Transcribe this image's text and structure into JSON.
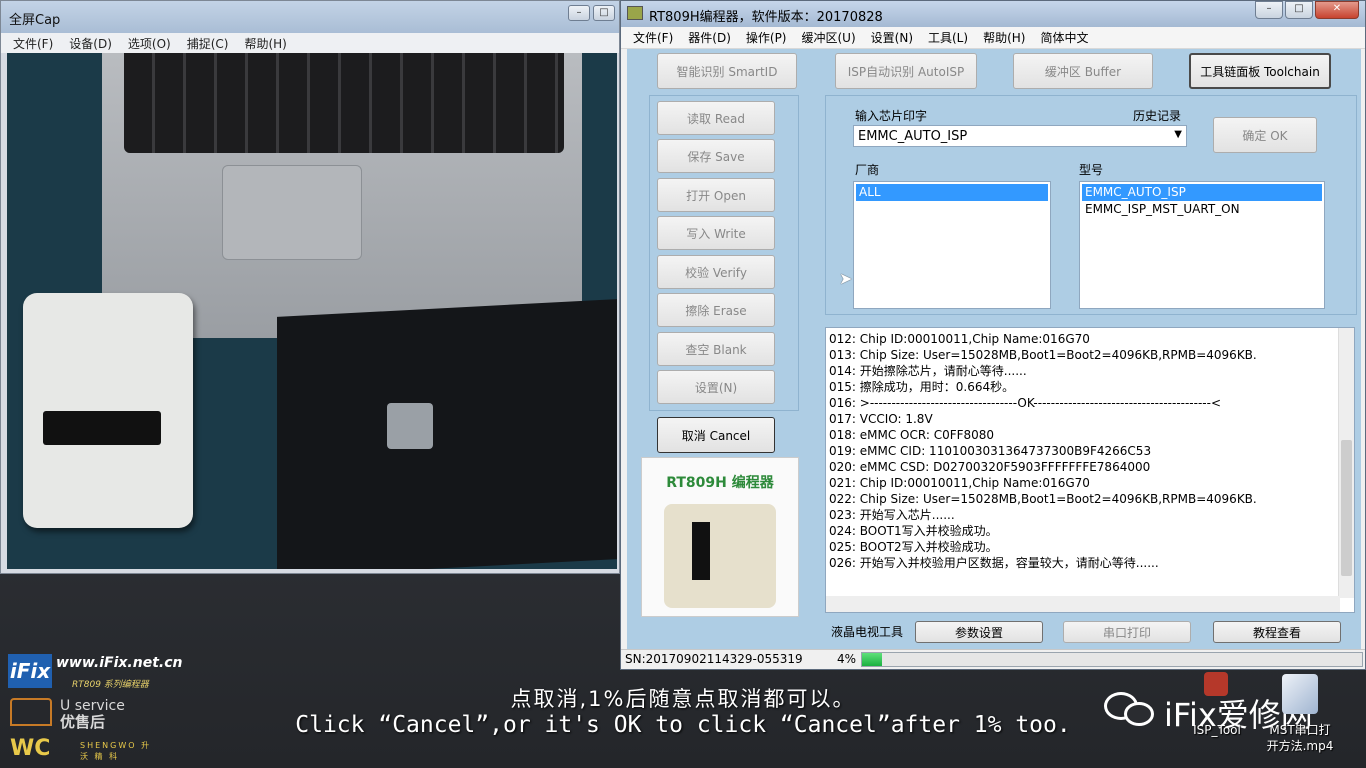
{
  "capture_window": {
    "title": "全屏Cap",
    "menu": [
      "文件(F)",
      "设备(D)",
      "选项(O)",
      "捕捉(C)",
      "帮助(H)"
    ]
  },
  "rt_window": {
    "title": "RT809H编程器，软件版本：20170828",
    "menu": [
      "文件(F)",
      "器件(D)",
      "操作(P)",
      "缓冲区(U)",
      "设置(N)",
      "工具(L)",
      "帮助(H)",
      "简体中文"
    ],
    "top_buttons": {
      "smartid": "智能识别 SmartID",
      "autoisp": "ISP自动识别 AutoISP",
      "buffer": "缓冲区 Buffer",
      "toolchain": "工具链面板 Toolchain"
    },
    "side_buttons": [
      "读取 Read",
      "保存 Save",
      "打开 Open",
      "写入 Write",
      "校验 Verify",
      "擦除 Erase",
      "查空 Blank",
      "设置(N)"
    ],
    "cancel_label": "取消 Cancel",
    "chip_input_label": "输入芯片印字",
    "history_label": "历史记录",
    "chip_input_value": "EMMC_AUTO_ISP",
    "ok_label": "确定 OK",
    "vendor_label": "厂商",
    "model_label": "型号",
    "vendors": [
      "ALL"
    ],
    "models": [
      "EMMC_AUTO_ISP",
      "EMMC_ISP_MST_UART_ON"
    ],
    "log_lines": [
      "012:  Chip ID:00010011,Chip Name:016G70",
      "013:  Chip Size: User=15028MB,Boot1=Boot2=4096KB,RPMB=4096KB.",
      "014:  开始擦除芯片，请耐心等待......",
      "015:  擦除成功，用时：0.664秒。",
      "016:  >----------------------------------OK-----------------------------------------<",
      "017:  VCCIO: 1.8V",
      "018:  eMMC OCR: C0FF8080",
      "019:  eMMC CID:  1101003031364737300B9F4266C53",
      "020:  eMMC CSD: D02700320F5903FFFFFFFE7864000",
      "021:  Chip ID:00010011,Chip Name:016G70",
      "022:  Chip Size: User=15028MB,Boot1=Boot2=4096KB,RPMB=4096KB.",
      "023:  开始写入芯片......",
      "024:  BOOT1写入并校验成功。",
      "025:  BOOT2写入并校验成功。",
      "026:  开始写入并校验用户区数据，容量较大，请耐心等待......"
    ],
    "lcd_tool_label": "液晶电视工具",
    "param_button": "参数设置",
    "serial_button": "串口打印",
    "tutorial_button": "教程查看",
    "photo_caption": "RT809H 编程器",
    "serial_number": "SN:20170902114329-055319",
    "progress_text": "4%",
    "progress_value": 0.04
  },
  "watermark": {
    "ifix_logo": "iFix",
    "ifix_url": "www.iFix.net.cn",
    "ifix_sub": "RT809 系列编程器",
    "uservice_top": "U service",
    "uservice_bottom": "优售后",
    "wc_logo": "WC",
    "wc_sub": "SHENGWO 升 沃 精 科",
    "brand": "iFix爱修网"
  },
  "subtitles": {
    "cn": "点取消,1%后随意点取消都可以。",
    "en": "Click “Cancel”,or it's OK to click “Cancel”after 1% too."
  },
  "desktop_icons": {
    "isp_tool": "ISP_Tool",
    "mst_video_line1": "MST串口打",
    "mst_video_line2": "开方法.mp4"
  },
  "colors": {
    "selection": "#3399ff",
    "progress": "#1bb142",
    "panel_bg": "#aecde4"
  }
}
